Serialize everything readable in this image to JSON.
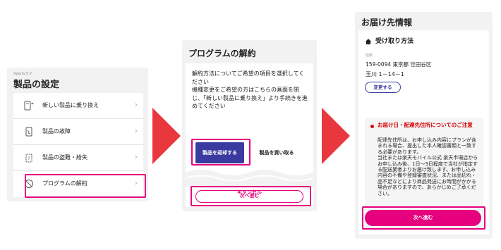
{
  "panel1": {
    "model": "Xperia 5 V",
    "title": "製品の設定",
    "items": [
      {
        "label": "新しい製品に乗り換え",
        "icon": "phone-swap-icon"
      },
      {
        "label": "製品の故障",
        "icon": "broken-phone-icon"
      },
      {
        "label": "製品の盗難・紛失",
        "icon": "lost-phone-icon"
      },
      {
        "label": "プログラムの解約",
        "icon": "cancel-circle-icon"
      }
    ],
    "chevron": "›"
  },
  "panel2": {
    "title": "プログラムの解約",
    "body": "解約方法についてご希望の項目を選択してください\n機種変更をご希望の方はこちらの画面を閉じ、「新しい製品に乗り換え」より手続きを進めてください",
    "option_return": "製品を返却する",
    "option_buy": "製品を買い取る",
    "next": "次へ進む",
    "cancel": "キャンセル"
  },
  "panel3": {
    "title": "お届け先情報",
    "section_title": "受け取り方法",
    "address_label": "住所",
    "address_line1": "159-0094 東京都 世田谷区",
    "address_line2": "玉川 1－14－1",
    "change": "変更する",
    "notice_title": "お届け日・配達先住所についてのご注意",
    "notice_body": "配達先住所は、お申し込み内容にプランが含まれる場合、提出した本人確認書類と一致する必要があります。\n当社または楽天モバイル公式 楽天市場店からお申し込み後、1日～3日程度で当社が指定する配送業者よりお届け致します。お申し込み内容の不備や登録審査状況、または品切れ・品不足などにより商品発送にお時間がかかる場合がありますので、あらかじめご了承ください。",
    "next": "次へ進む"
  },
  "colors": {
    "accent": "#e6007e",
    "primary": "#3a3aa0",
    "arrow": "#e8383d",
    "warning": "#d60000"
  }
}
